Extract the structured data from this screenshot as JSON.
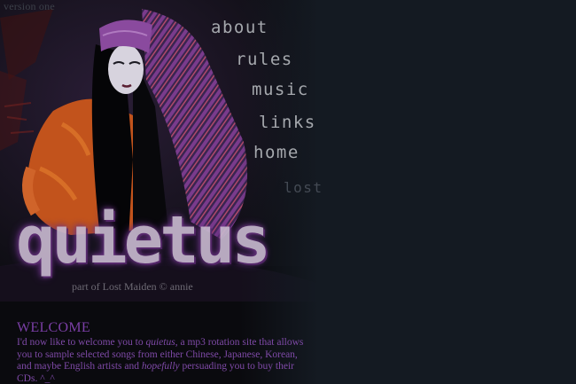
{
  "site": {
    "version": "version one",
    "logo": "quietus",
    "byline": "part of Lost Maiden © annie"
  },
  "nav": {
    "about": "about",
    "rules": "rules",
    "music": "music",
    "links": "links",
    "home": "home",
    "lost": "lost"
  },
  "welcome": {
    "title": "WELCOME",
    "p1": "I'd now like to welcome you to ",
    "em1": "quietus",
    "p2": ", a mp3 rotation site that allows you to sample selected songs from either Chinese, Japanese, Korean, and maybe English artists and ",
    "em2": "hopefully",
    "p3": " persuading you to buy their CDs. ^_^"
  },
  "colors": {
    "background": "#141a22",
    "nav_text": "#a5a8ad",
    "welcome_accent": "#7b3fa6"
  }
}
